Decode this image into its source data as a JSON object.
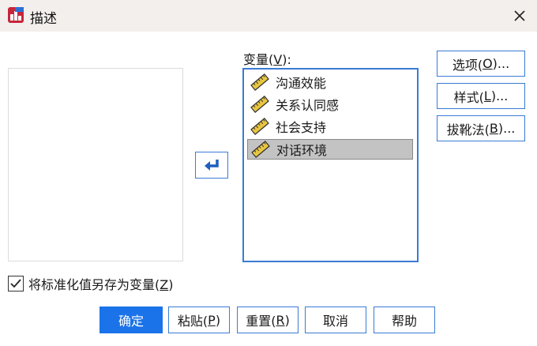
{
  "window": {
    "title": "描述",
    "close_icon": "close-icon",
    "app_icon": "spss-app-icon"
  },
  "variables_label": {
    "text": "变量(",
    "mnemonic": "V",
    "suffix": "):"
  },
  "variables": [
    {
      "label": "沟通效能",
      "icon": "scale-ruler-icon",
      "selected": false
    },
    {
      "label": "关系认同感",
      "icon": "scale-ruler-icon",
      "selected": false
    },
    {
      "label": "社会支持",
      "icon": "scale-ruler-icon",
      "selected": false
    },
    {
      "label": "对话环境",
      "icon": "scale-ruler-icon",
      "selected": true
    }
  ],
  "move_button_icon": "arrow-left-icon",
  "side_buttons": [
    {
      "text": "选项(",
      "mnemonic": "O",
      "suffix": ")..."
    },
    {
      "text": "样式(",
      "mnemonic": "L",
      "suffix": ")..."
    },
    {
      "text": "拔靴法(",
      "mnemonic": "B",
      "suffix": ")..."
    }
  ],
  "save_standardized": {
    "text": "将标准化值另存为变量(",
    "mnemonic": "Z",
    "suffix": ")",
    "checked": true
  },
  "bottom_buttons": [
    {
      "text": "确定",
      "mnemonic": "",
      "suffix": ""
    },
    {
      "text": "粘贴(",
      "mnemonic": "P",
      "suffix": ")"
    },
    {
      "text": "重置(",
      "mnemonic": "R",
      "suffix": ")"
    },
    {
      "text": "取消",
      "mnemonic": "",
      "suffix": ""
    },
    {
      "text": "帮助",
      "mnemonic": "",
      "suffix": ""
    }
  ],
  "colors": {
    "accent": "#3a7bd5",
    "primary": "#1a73e8",
    "selection": "#c3c3c3",
    "titlebar": "#f3efed"
  }
}
